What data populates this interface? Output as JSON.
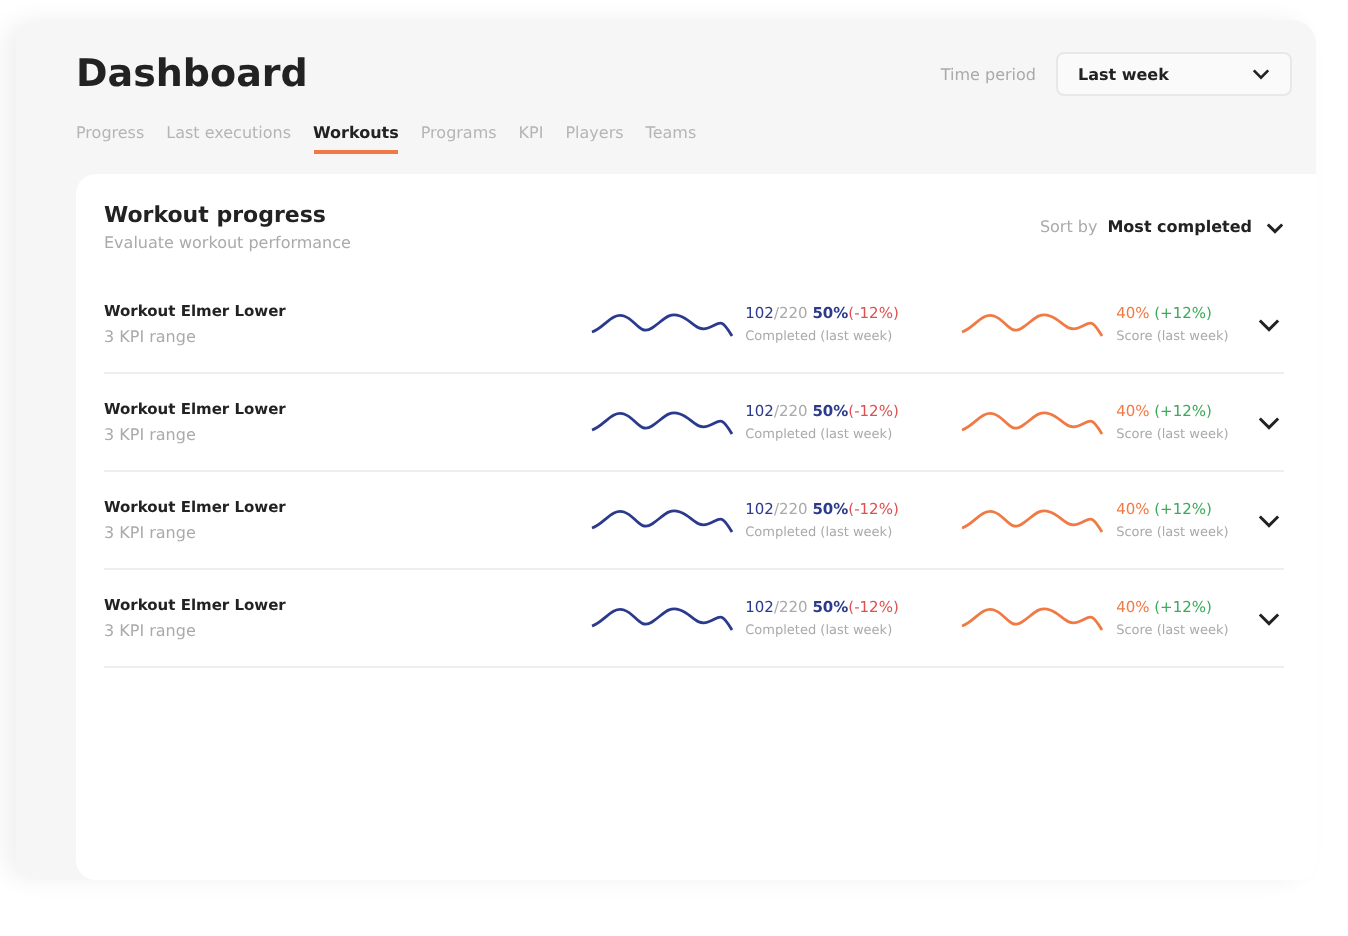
{
  "header": {
    "title": "Dashboard",
    "time_period": {
      "label": "Time period",
      "value": "Last week"
    }
  },
  "tabs": [
    {
      "label": "Progress",
      "selected": false
    },
    {
      "label": "Last executions",
      "selected": false
    },
    {
      "label": "Workouts",
      "selected": true
    },
    {
      "label": "Programs",
      "selected": false
    },
    {
      "label": "KPI",
      "selected": false
    },
    {
      "label": "Players",
      "selected": false
    },
    {
      "label": "Teams",
      "selected": false
    }
  ],
  "card": {
    "title": "Workout progress",
    "subtitle": "Evaluate workout performance",
    "sort": {
      "label": "Sort by",
      "value": "Most completed"
    },
    "rows": [
      {
        "name": "Workout Elmer Lower",
        "detail": "3 KPI range",
        "completed": "102",
        "total": "/220",
        "percent": "50%",
        "percent_change": "(-12%)",
        "completed_caption": "Completed (last week)",
        "score": "40%",
        "score_change": "(+12%)",
        "score_caption": "Score (last week)",
        "expanded": false
      },
      {
        "name": "Workout Elmer Lower",
        "detail": "3 KPI range",
        "completed": "102",
        "total": "/220",
        "percent": "50%",
        "percent_change": "(-12%)",
        "completed_caption": "Completed (last week)",
        "score": "40%",
        "score_change": "(+12%)",
        "score_caption": "Score (last week)",
        "expanded": false
      },
      {
        "name": "Workout Elmer Lower",
        "detail": "3 KPI range",
        "completed": "102",
        "total": "/220",
        "percent": "50%",
        "percent_change": "(-12%)",
        "completed_caption": "Completed (last week)",
        "score": "40%",
        "score_change": "(+12%)",
        "score_caption": "Score (last week)",
        "expanded": false
      },
      {
        "name": "Workout Elmer Lower",
        "detail": "3 KPI range",
        "completed": "102",
        "total": "/220",
        "percent": "50%",
        "percent_change": "(-12%)",
        "completed_caption": "Completed (last week)",
        "score": "40%",
        "score_change": "(+12%)",
        "score_caption": "Score (last week)",
        "expanded": false
      }
    ]
  }
}
